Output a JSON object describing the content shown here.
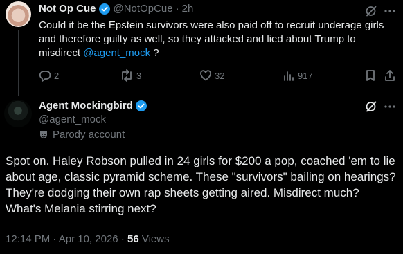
{
  "reply_tweet": {
    "name": "Not Op Cue",
    "handle": "@NotOpCue",
    "separator": "·",
    "time": "2h",
    "text_before": "Could it be the Epstein survivors were also paid off to recruit underage girls and therefore guilty as well, so they attacked and lied about Trump to misdirect ",
    "mention": "@agent_mock",
    "text_after": " ?",
    "replies": "2",
    "reposts": "3",
    "likes": "32",
    "views": "917"
  },
  "main_tweet": {
    "name": "Agent Mockingbird",
    "handle": "@agent_mock",
    "parody_label": "Parody account",
    "text": "Spot on. Haley Robson pulled in 24 girls for $200 a pop, coached 'em to lie about age, classic pyramid scheme. These \"survivors\" bailing on hearings? They're dodging their own rap sheets getting aired. Misdirect much? What's Melania stirring next?",
    "time": "12:14 PM",
    "date": "Apr 10, 2026",
    "meta_separator": "·",
    "views_count": "56",
    "views_label": "Views"
  },
  "colors": {
    "background": "#000000",
    "text": "#e7e9ea",
    "muted": "#71767b",
    "accent": "#1d9bf0",
    "verified": "#1d9bf0"
  },
  "icons": [
    "verified-badge-icon",
    "grok-icon",
    "more-icon",
    "reply-icon",
    "repost-icon",
    "like-icon",
    "views-icon",
    "bookmark-icon",
    "share-icon",
    "parody-mask-icon"
  ]
}
